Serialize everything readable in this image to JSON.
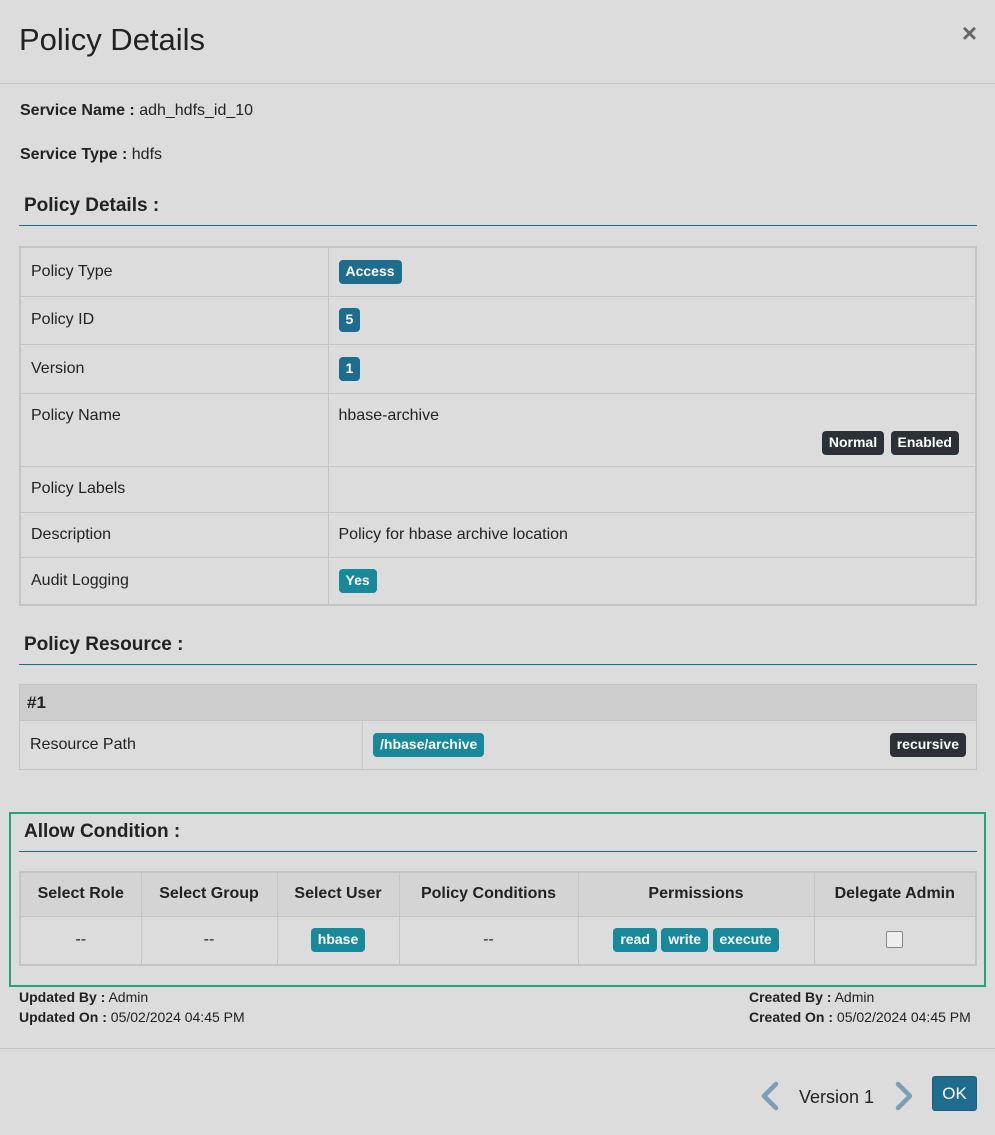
{
  "modal": {
    "title": "Policy Details",
    "close_symbol": "×"
  },
  "service": {
    "name_label": "Service Name :",
    "name_value": "adh_hdfs_id_10",
    "type_label": "Service Type :",
    "type_value": "hdfs"
  },
  "policy_details": {
    "section_title": "Policy Details :",
    "rows": {
      "policy_type": {
        "label": "Policy Type",
        "badge": "Access"
      },
      "policy_id": {
        "label": "Policy ID",
        "badge": "5"
      },
      "version": {
        "label": "Version",
        "badge": "1"
      },
      "policy_name": {
        "label": "Policy Name",
        "value": "hbase-archive",
        "badges": [
          "Normal",
          "Enabled"
        ]
      },
      "policy_labels": {
        "label": "Policy Labels",
        "value": ""
      },
      "description": {
        "label": "Description",
        "value": "Policy for hbase archive location"
      },
      "audit_logging": {
        "label": "Audit Logging",
        "badge": "Yes"
      }
    }
  },
  "policy_resource": {
    "section_title": "Policy Resource :",
    "group_header": "#1",
    "resource_path": {
      "label": "Resource Path",
      "value": "/hbase/archive",
      "flag": "recursive"
    }
  },
  "allow_condition": {
    "section_title": "Allow Condition :",
    "headers": [
      "Select Role",
      "Select Group",
      "Select User",
      "Policy Conditions",
      "Permissions",
      "Delegate Admin"
    ],
    "row": {
      "role": "--",
      "group": "--",
      "user": "hbase",
      "conditions": "--",
      "permissions": [
        "read",
        "write",
        "execute"
      ],
      "delegate_admin": false
    }
  },
  "audit_info": {
    "updated_by_label": "Updated By :",
    "updated_by": "Admin",
    "updated_on_label": "Updated On :",
    "updated_on": "05/02/2024 04:45 PM",
    "created_by_label": "Created By :",
    "created_by": "Admin",
    "created_on_label": "Created On :",
    "created_on": "05/02/2024 04:45 PM"
  },
  "footer": {
    "version_label": "Version 1",
    "ok_label": "OK"
  },
  "colors": {
    "primary": "#1f6d8e",
    "teal": "#17899a",
    "dark": "#2b3137",
    "highlight": "#23a47a"
  }
}
